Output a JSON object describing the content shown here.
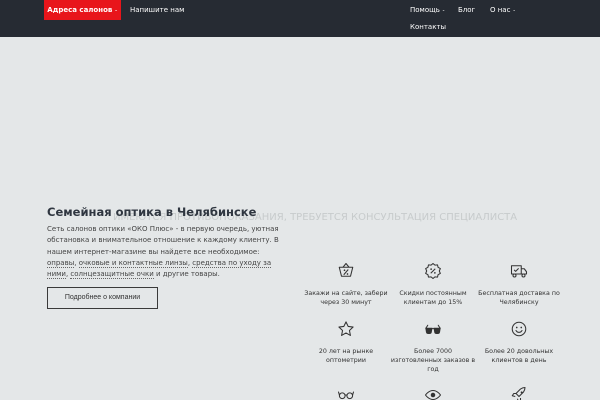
{
  "nav": {
    "addresses": "Адреса салонов",
    "write_us": "Напишите нам",
    "help": "Помощь",
    "blog": "Блог",
    "about": "О нас",
    "contacts": "Контакты",
    "caret": "⌄"
  },
  "banner": {
    "text": "ИМЕЮТСЯ ПРОТИВОПОКАЗАНИЯ, ТРЕБУЕТСЯ КОНСУЛЬТАЦИЯ СПЕЦИАЛИСТА"
  },
  "hero": {
    "title": "Семейная оптика в Челябинске",
    "desc_1": "Сеть салонов оптики «ОКО Плюс» - в первую очередь, уютная обстановка и внимательное отношение к каждому клиенту. В нашем интернет-магазине вы найдете все необходимое: ",
    "link_frames": "оправы",
    "sep_1": ", ",
    "link_glasses": "очковые и контактные линзы",
    "sep_2": ", ",
    "link_care": "средства по уходу за ними",
    "sep_3": ", ",
    "link_sun": "солнцезащитные очки",
    "desc_end": " и другие товары.",
    "more_button": "Подробнее о компании"
  },
  "features": [
    {
      "icon": "basket-percent-icon",
      "label": "Закажи на сайте, забери через 30 минут"
    },
    {
      "icon": "discount-badge-icon",
      "label": "Скидки постоянным клиентам до 15%"
    },
    {
      "icon": "delivery-truck-icon",
      "label": "Бесплатная доставка по Челябинску"
    },
    {
      "icon": "star-icon",
      "label": "20 лет на рынке оптометрии"
    },
    {
      "icon": "glasses-icon",
      "label": "Более 7000 изготовленных заказов в год"
    },
    {
      "icon": "smile-icon",
      "label": "Более 20 довольных клиентов в день"
    },
    {
      "icon": "sunglasses-icon",
      "label": ""
    },
    {
      "icon": "eye-icon",
      "label": ""
    },
    {
      "icon": "rocket-icon",
      "label": ""
    }
  ],
  "colors": {
    "topbar": "#262b33",
    "accent": "#e8151b",
    "background": "#e4e7e8"
  }
}
